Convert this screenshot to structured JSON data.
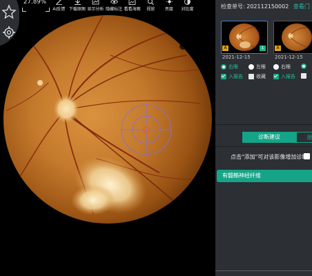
{
  "viewer": {
    "zoom": "27.89%",
    "tools": [
      {
        "label": "AI反馈",
        "icon": "pen-icon"
      },
      {
        "label": "下载原图",
        "icon": "download-icon"
      },
      {
        "label": "显示分析",
        "icon": "analysis-icon"
      },
      {
        "label": "隐藏标注",
        "icon": "eye-icon"
      },
      {
        "label": "看看海图",
        "icon": "image-icon"
      },
      {
        "label": "视放",
        "icon": "zoom-icon"
      },
      {
        "label": "亮度",
        "icon": "brightness-icon"
      },
      {
        "label": "对比度",
        "icon": "contrast-icon"
      }
    ],
    "side_icons": [
      "star-icon",
      "gear-icon"
    ]
  },
  "panel": {
    "exam_label": "检查单号:",
    "exam_number": "202112150002",
    "exam_link": "查看门",
    "thumbnails": [
      {
        "tag_left": "A",
        "tag_right": "1",
        "date": "2021-12-15",
        "right_eye": "右眼",
        "left_eye": "左眼",
        "report": "入报告",
        "favorite": "收藏"
      },
      {
        "tag_left": "A",
        "date": "2021-12-15",
        "right_eye": "右眼",
        "report": "入报告"
      }
    ],
    "tabs": [
      "诊断建议",
      "眼"
    ],
    "hint": "点击\"添加\"可对该影像增加诊断",
    "diagnosis": "有髓鞘神经纤维"
  },
  "colors": {
    "accent": "#15a487",
    "panel_bg": "#2c2f33",
    "marker": "#8a70c8"
  }
}
